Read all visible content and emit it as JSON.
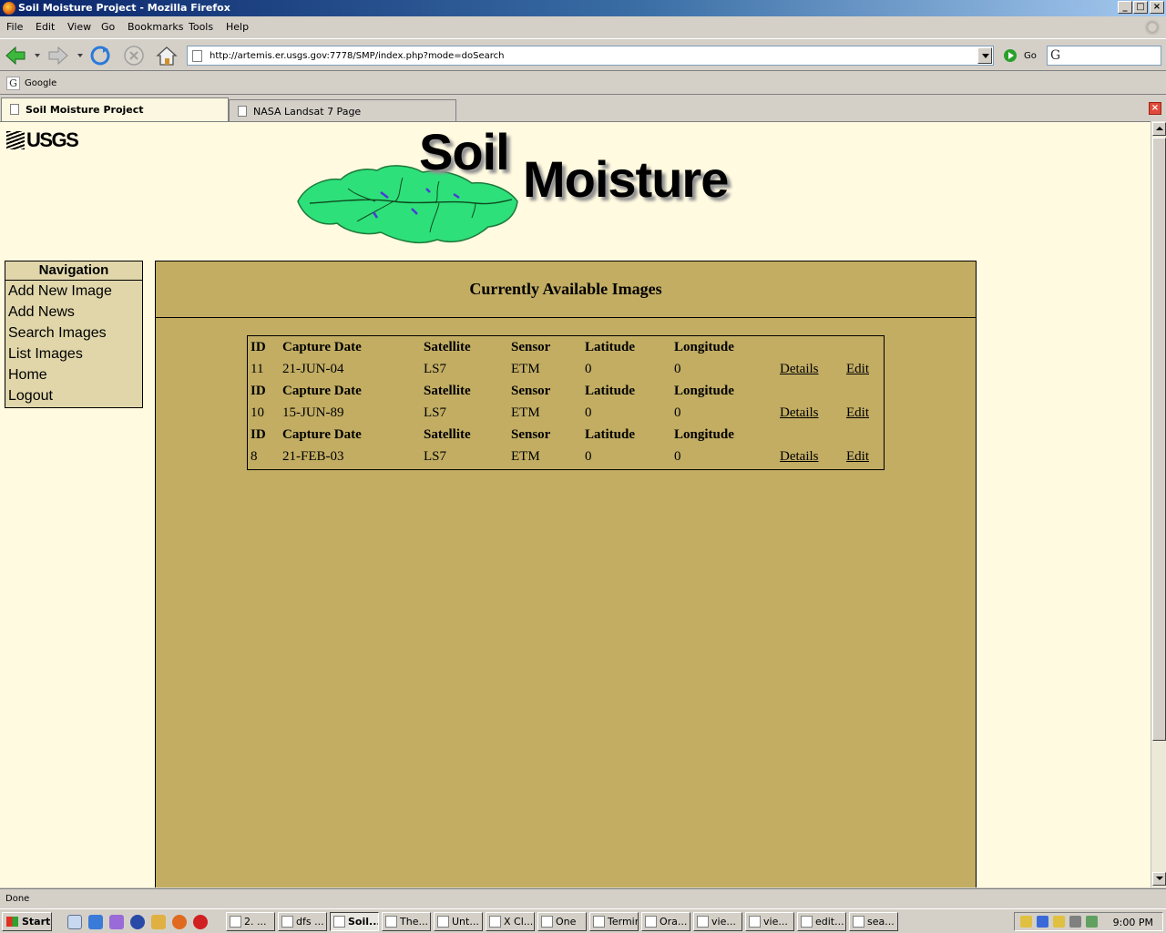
{
  "window": {
    "title": "Soil Moisture Project - Mozilla Firefox",
    "minimize": "_",
    "maximize": "□",
    "close": "×"
  },
  "menu": [
    "File",
    "Edit",
    "View",
    "Go",
    "Bookmarks",
    "Tools",
    "Help"
  ],
  "toolbar": {
    "url": "http://artemis.er.usgs.gov:7778/SMP/index.php?mode=doSearch",
    "go_label": "Go",
    "search_engine_glyph": "G"
  },
  "bookmarks": [
    {
      "label": "Google",
      "icon": "google-icon"
    }
  ],
  "tabs": [
    {
      "label": "Soil Moisture Project",
      "active": true
    },
    {
      "label": "NASA Landsat 7 Page",
      "active": false
    }
  ],
  "page": {
    "usgs_logo": "USGS",
    "banner": {
      "line1": "Soil",
      "line2": "Moisture"
    },
    "navigation": {
      "title": "Navigation",
      "items": [
        "Add New Image",
        "Add News",
        "Search Images",
        "List Images",
        "Home",
        "Logout"
      ]
    },
    "panel_title": "Currently Available Images",
    "table": {
      "headers": [
        "ID",
        "Capture Date",
        "Satellite",
        "Sensor",
        "Latitude",
        "Longitude"
      ],
      "rows": [
        {
          "id": "11",
          "date": "21-JUN-04",
          "satellite": "LS7",
          "sensor": "ETM",
          "lat": "0",
          "lon": "0",
          "details": "Details",
          "edit": "Edit"
        },
        {
          "id": "10",
          "date": "15-JUN-89",
          "satellite": "LS7",
          "sensor": "ETM",
          "lat": "0",
          "lon": "0",
          "details": "Details",
          "edit": "Edit"
        },
        {
          "id": "8",
          "date": "21-FEB-03",
          "satellite": "LS7",
          "sensor": "ETM",
          "lat": "0",
          "lon": "0",
          "details": "Details",
          "edit": "Edit"
        }
      ]
    }
  },
  "status": "Done",
  "taskbar": {
    "start": "Start",
    "buttons": [
      "2. ...",
      "dfs ...",
      "Soil...",
      "The...",
      "Unt...",
      "X Cl...",
      "One",
      "Terminal",
      "Ora...",
      "vie...",
      "vie...",
      "edit...",
      "sea..."
    ],
    "clock": "9:00 PM"
  },
  "colors": {
    "page_bg": "#fffae0",
    "panel_bg": "#c2ad63",
    "nav_bg": "#e0d6aa",
    "map_green": "#2ee07a"
  }
}
